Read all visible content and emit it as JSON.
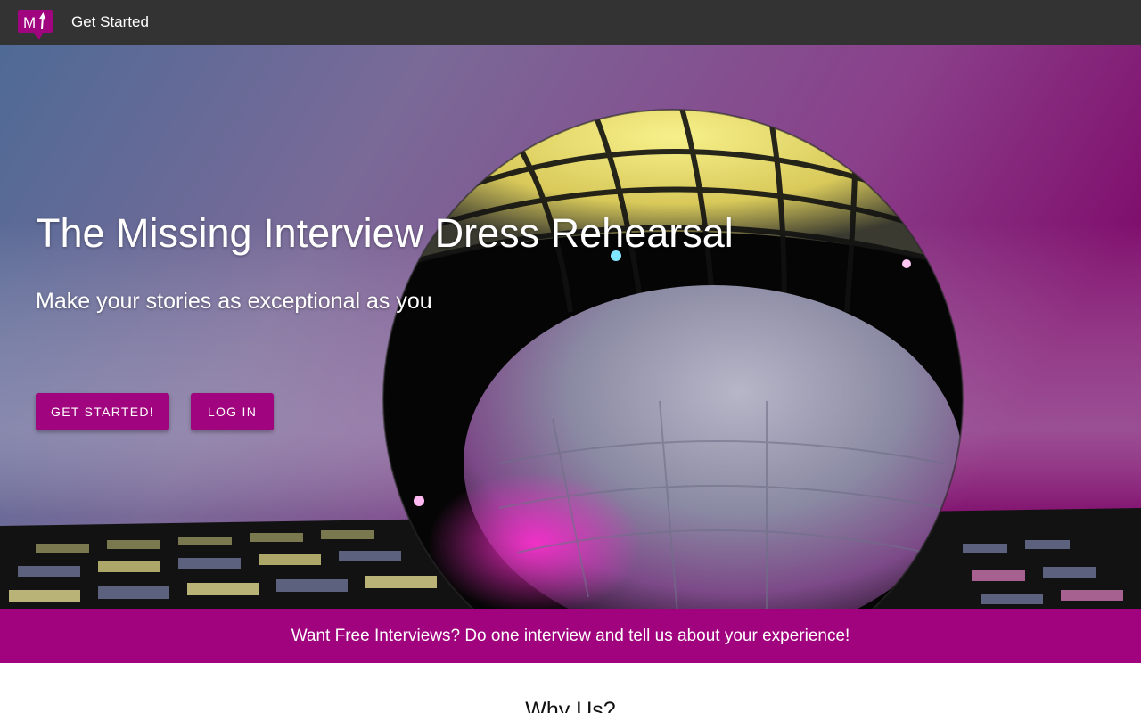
{
  "nav": {
    "logo_text": "M",
    "link_label": "Get Started"
  },
  "hero": {
    "title": "The Missing Interview Dress Rehearsal",
    "subtitle": "Make your stories as exceptional as you",
    "primary_button": "GET STARTED!",
    "secondary_button": "LOG IN"
  },
  "promo": {
    "text": "Want Free Interviews? Do one interview and tell us about your experience!"
  },
  "why": {
    "title": "Why Us?"
  },
  "colors": {
    "brand": "#a0047e",
    "topbar": "#333333"
  }
}
